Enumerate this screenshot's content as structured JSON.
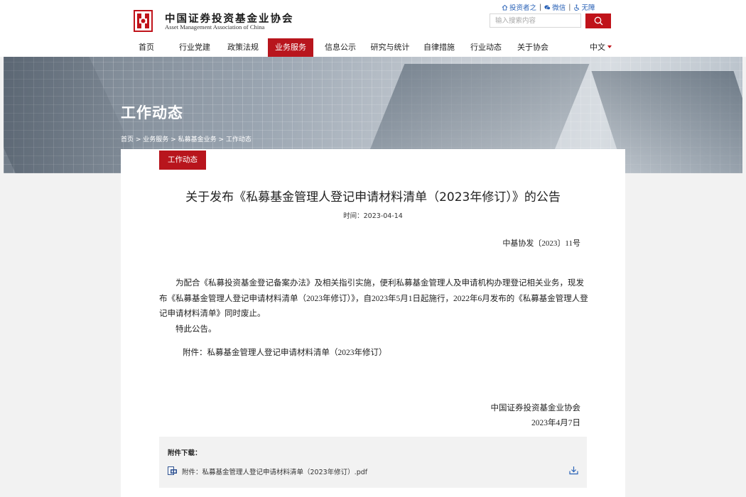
{
  "brand": {
    "name_cn": "中国证券投资基金业协会",
    "name_en": "Asset Management Association of China",
    "accent_color": "#b8151d",
    "logo_icon": "amac-logo-icon"
  },
  "quick_links": [
    {
      "label": "投资者之",
      "icon": "home-icon"
    },
    {
      "label": "微信",
      "icon": "wechat-icon"
    },
    {
      "label": "无障",
      "icon": "accessibility-icon"
    }
  ],
  "search": {
    "placeholder": "输入搜索内容",
    "button_icon": "search-icon"
  },
  "nav": {
    "items": [
      {
        "label": "首页",
        "active": false
      },
      {
        "label": "行业党建",
        "active": false
      },
      {
        "label": "政策法规",
        "active": false
      },
      {
        "label": "业务服务",
        "active": true
      },
      {
        "label": "信息公示",
        "active": false
      },
      {
        "label": "研究与统计",
        "active": false
      },
      {
        "label": "自律措施",
        "active": false
      },
      {
        "label": "行业动态",
        "active": false
      },
      {
        "label": "关于协会",
        "active": false
      }
    ],
    "language": "中文"
  },
  "banner": {
    "title": "工作动态",
    "breadcrumb": [
      "首页",
      "业务服务",
      "私募基金业务",
      "工作动态"
    ],
    "breadcrumb_separator": " > "
  },
  "section_tab": "工作动态",
  "article": {
    "title": "关于发布《私募基金管理人登记申请材料清单（2023年修订）》的公告",
    "time": "时间：2023-04-14",
    "doc_number": "中基协发〔2023〕11号",
    "body_paragraph": "为配合《私募投资基金登记备案办法》及相关指引实施，便利私募基金管理人及申请机构办理登记相关业务，现发布《私募基金管理人登记申请材料清单（2023年修订）》，自2023年5月1日起施行，2022年6月发布的《私募基金管理人登记申请材料清单》同时废止。",
    "closing": "特此公告。",
    "attachment_line": "附件：私募基金管理人登记申请材料清单（2023年修订）",
    "signature_org": "中国证券投资基金业协会",
    "signature_date": "2023年4月7日"
  },
  "downloads": {
    "heading": "附件下载：",
    "files": [
      {
        "name": "附件：私募基金管理人登记申请材料清单（2023年修订）.pdf",
        "icon": "pdf-file-icon",
        "action_icon": "download-icon"
      }
    ]
  }
}
